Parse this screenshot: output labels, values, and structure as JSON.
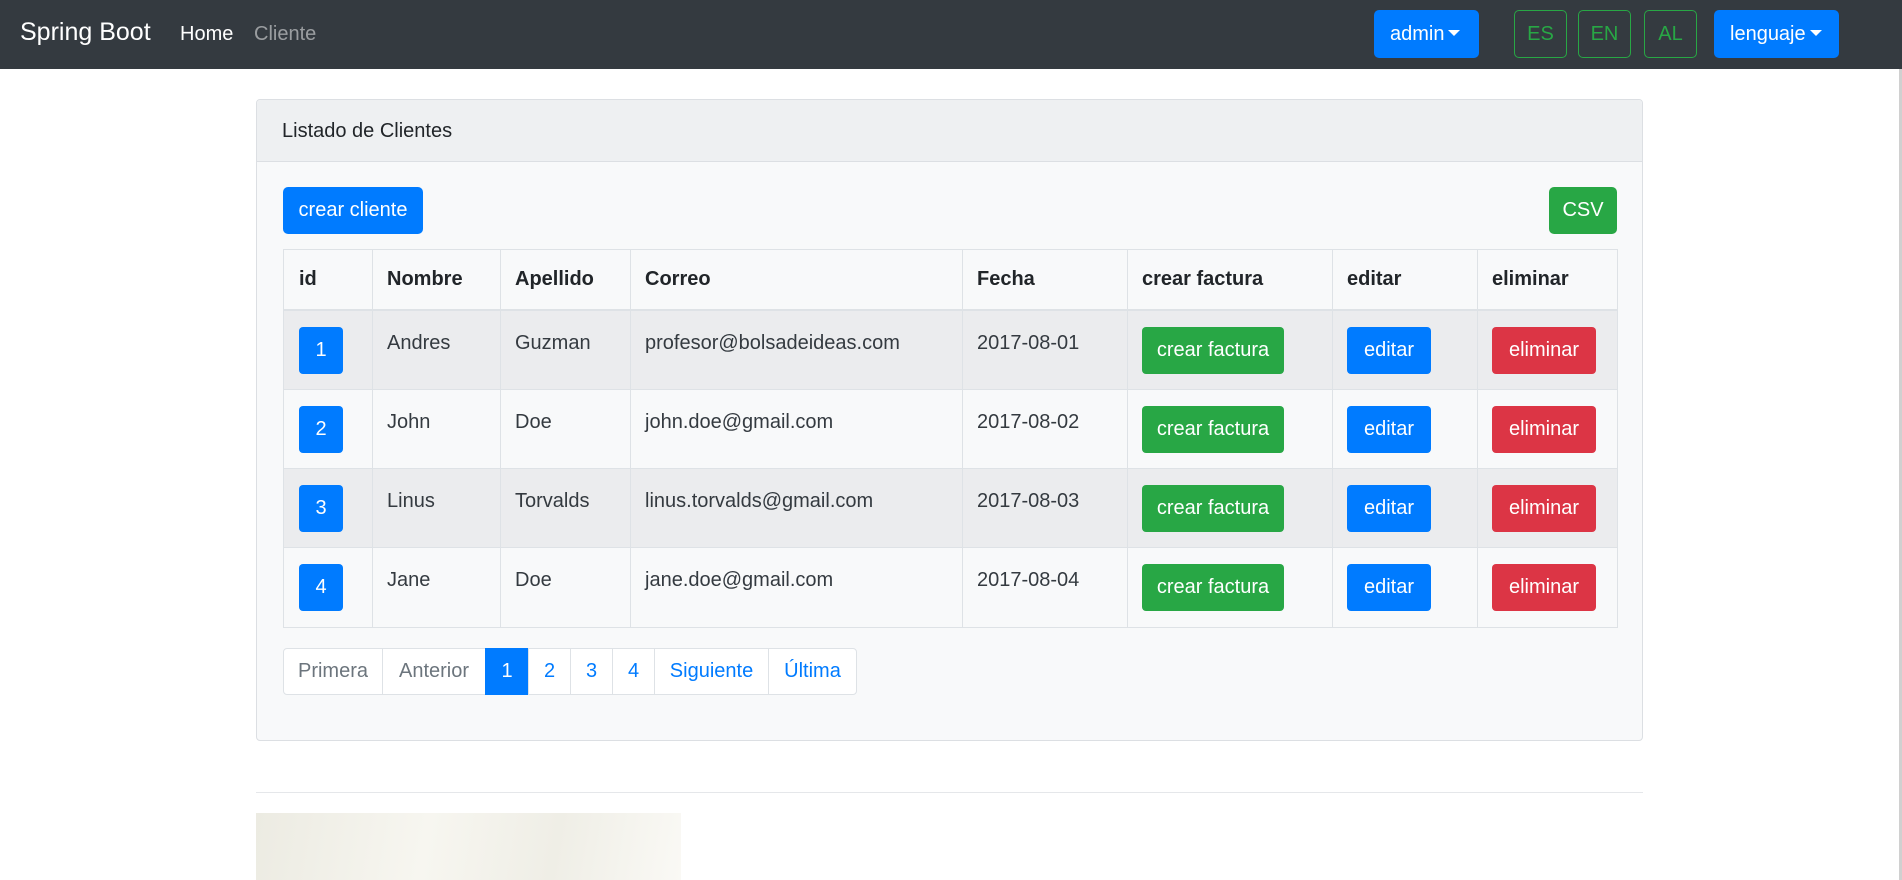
{
  "navbar": {
    "brand": "Spring Boot",
    "links": [
      "Home",
      "Cliente"
    ],
    "user_menu": "admin",
    "lang_buttons": [
      "ES",
      "EN",
      "AL"
    ],
    "language_menu": "lenguaje"
  },
  "card": {
    "title": "Listado de Clientes",
    "create_button": "crear cliente",
    "csv_button": "CSV"
  },
  "table": {
    "headers": [
      "id",
      "Nombre",
      "Apellido",
      "Correo",
      "Fecha",
      "crear factura",
      "editar",
      "eliminar"
    ],
    "rows": [
      {
        "id": "1",
        "nombre": "Andres",
        "apellido": "Guzman",
        "correo": "profesor@bolsadeideas.com",
        "fecha": "2017-08-01",
        "factura": "crear factura",
        "editar": "editar",
        "eliminar": "eliminar"
      },
      {
        "id": "2",
        "nombre": "John",
        "apellido": "Doe",
        "correo": "john.doe@gmail.com",
        "fecha": "2017-08-02",
        "factura": "crear factura",
        "editar": "editar",
        "eliminar": "eliminar"
      },
      {
        "id": "3",
        "nombre": "Linus",
        "apellido": "Torvalds",
        "correo": "linus.torvalds@gmail.com",
        "fecha": "2017-08-03",
        "factura": "crear factura",
        "editar": "editar",
        "eliminar": "eliminar"
      },
      {
        "id": "4",
        "nombre": "Jane",
        "apellido": "Doe",
        "correo": "jane.doe@gmail.com",
        "fecha": "2017-08-04",
        "factura": "crear factura",
        "editar": "editar",
        "eliminar": "eliminar"
      }
    ]
  },
  "pagination": {
    "first": "Primera",
    "previous": "Anterior",
    "pages": [
      "1",
      "2",
      "3",
      "4"
    ],
    "current_page": 1,
    "next": "Siguiente",
    "last": "Última"
  },
  "colors": {
    "navbar": "#343a40",
    "primary": "#007bff",
    "success": "#28a745",
    "danger": "#dc3545"
  }
}
